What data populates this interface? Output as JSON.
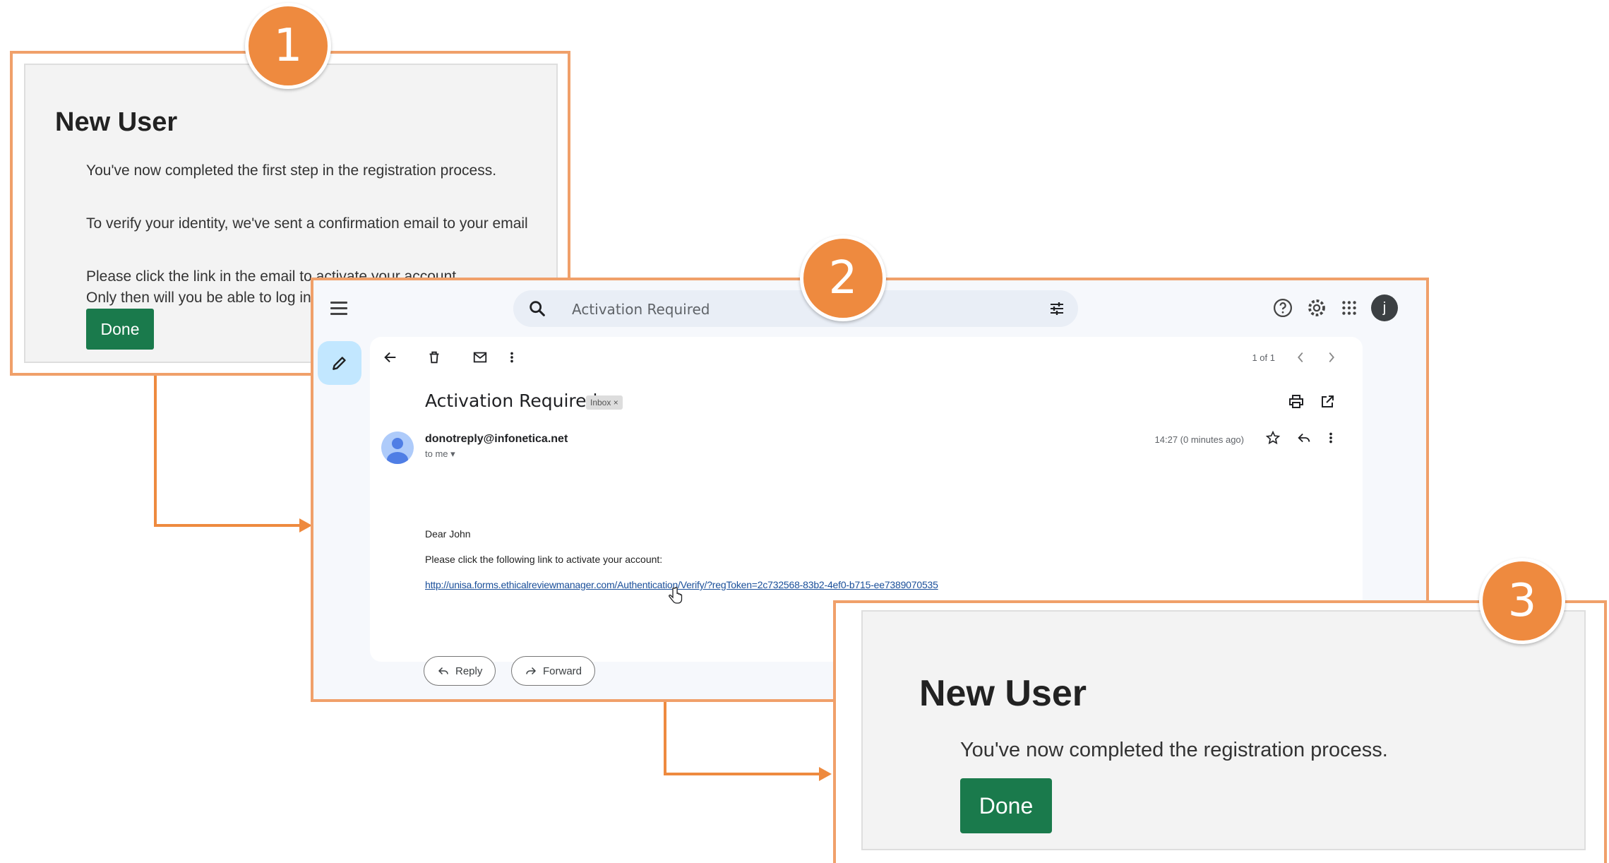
{
  "badges": [
    "1",
    "2",
    "3"
  ],
  "step1": {
    "title": "New User",
    "line1": "You've now completed the first step in the registration process.",
    "line2": "To verify your identity, we've sent a confirmation email to your email",
    "line3": "Please click the link in the email to activate your account.",
    "line4": "Only then will you be able to log in.",
    "done_label": "Done"
  },
  "email": {
    "search_query": "Activation Required",
    "avatar_letter": "j",
    "pager": "1 of 1",
    "subject": "Activation Required",
    "label": "Inbox ×",
    "sender": "donotreply@infonetica.net",
    "to_me": "to me ▾",
    "time": "14:27 (0 minutes ago)",
    "greeting": "Dear John",
    "instruction": "Please click the following link to activate your account:",
    "link": "http://unisa.forms.ethicalreviewmanager.com/Authentication/Verify/?regToken=2c732568-83b2-4ef0-b715-ee7389070535",
    "reply_label": "Reply",
    "forward_label": "Forward"
  },
  "step3": {
    "title": "New User",
    "line1": "You've now completed the registration process.",
    "done_label": "Done"
  },
  "colors": {
    "accent": "#ee8a3f",
    "frame": "#f0a06a",
    "done_button": "#1a7a4c"
  }
}
